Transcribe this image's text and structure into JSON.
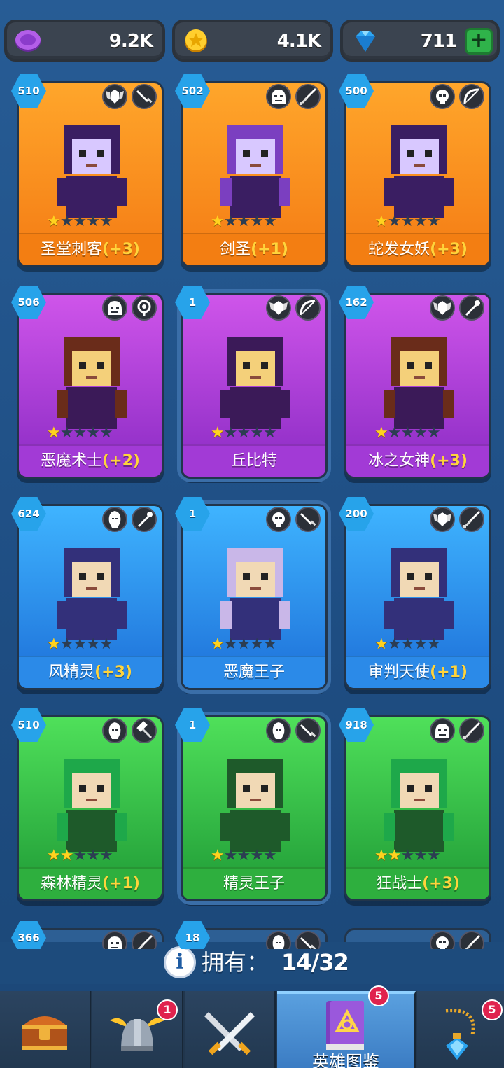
{
  "resources": {
    "purple_currency": "9.2K",
    "gold_coins": "4.1K",
    "gems": "711",
    "gems_add_label": "+"
  },
  "heroes": [
    {
      "name": "圣堂刺客",
      "plus": "(+3)",
      "level": "510",
      "stars": 1,
      "rarity": "orange",
      "faction_icon": "winged-shield-icon",
      "weapon_icon": "dagger-icon",
      "state": "owned"
    },
    {
      "name": "剑圣",
      "plus": "(+1)",
      "level": "502",
      "stars": 1,
      "rarity": "orange",
      "faction_icon": "orc-helm-icon",
      "weapon_icon": "sword-icon",
      "state": "owned"
    },
    {
      "name": "蛇发女妖",
      "plus": "(+3)",
      "level": "500",
      "stars": 1,
      "rarity": "orange",
      "faction_icon": "demon-skull-icon",
      "weapon_icon": "bow-icon",
      "state": "owned"
    },
    {
      "name": "恶魔术士",
      "plus": "(+2)",
      "level": "506",
      "stars": 1,
      "rarity": "purple",
      "faction_icon": "orc-helm-icon",
      "weapon_icon": "orb-icon",
      "state": "owned"
    },
    {
      "name": "丘比特",
      "plus": "",
      "level": "1",
      "stars": 1,
      "rarity": "purple",
      "faction_icon": "winged-shield-icon",
      "weapon_icon": "bow-icon",
      "state": "selected"
    },
    {
      "name": "冰之女神",
      "plus": "(+3)",
      "level": "162",
      "stars": 1,
      "rarity": "purple",
      "faction_icon": "winged-shield-icon",
      "weapon_icon": "staff-icon",
      "state": "owned"
    },
    {
      "name": "风精灵",
      "plus": "(+3)",
      "level": "624",
      "stars": 1,
      "rarity": "blue",
      "faction_icon": "elf-icon",
      "weapon_icon": "staff-icon",
      "state": "owned"
    },
    {
      "name": "恶魔王子",
      "plus": "",
      "level": "1",
      "stars": 1,
      "rarity": "blue",
      "faction_icon": "demon-skull-icon",
      "weapon_icon": "dagger-icon",
      "state": "selected"
    },
    {
      "name": "审判天使",
      "plus": "(+1)",
      "level": "200",
      "stars": 1,
      "rarity": "blue",
      "faction_icon": "winged-shield-icon",
      "weapon_icon": "sword-icon",
      "state": "owned"
    },
    {
      "name": "森林精灵",
      "plus": "(+1)",
      "level": "510",
      "stars": 2,
      "rarity": "green",
      "faction_icon": "elf-icon",
      "weapon_icon": "hammer-icon",
      "state": "owned"
    },
    {
      "name": "精灵王子",
      "plus": "",
      "level": "1",
      "stars": 1,
      "rarity": "green",
      "faction_icon": "elf-icon",
      "weapon_icon": "dagger-icon",
      "state": "selected"
    },
    {
      "name": "狂战士",
      "plus": "(+3)",
      "level": "918",
      "stars": 2,
      "rarity": "green",
      "faction_icon": "orc-helm-icon",
      "weapon_icon": "sword-icon",
      "state": "owned"
    },
    {
      "name": "",
      "plus": "",
      "level": "366",
      "stars": 0,
      "rarity": "green",
      "faction_icon": "orc-helm-icon",
      "weapon_icon": "sword-icon",
      "state": "partial"
    },
    {
      "name": "",
      "plus": "",
      "level": "18",
      "stars": 0,
      "rarity": "blue",
      "faction_icon": "elf-icon",
      "weapon_icon": "dagger-icon",
      "state": "partial"
    },
    {
      "name": "",
      "plus": "",
      "level": "",
      "stars": 0,
      "rarity": "blue",
      "faction_icon": "demon-skull-icon",
      "weapon_icon": "sword-icon",
      "state": "partial"
    }
  ],
  "owned": {
    "label": "拥有：",
    "count": "14/32"
  },
  "nav": {
    "tabs": [
      {
        "id": "chest",
        "icon": "treasure-chest-icon",
        "badge": ""
      },
      {
        "id": "heroes",
        "icon": "winged-helmet-icon",
        "badge": "1"
      },
      {
        "id": "battle",
        "icon": "crossed-swords-icon",
        "badge": ""
      },
      {
        "id": "codex",
        "icon": "spell-book-icon",
        "badge": "5",
        "label": "英雄图鉴",
        "active": true
      },
      {
        "id": "equipment",
        "icon": "amulet-icon",
        "badge": "5"
      }
    ]
  },
  "colors": {
    "background": "#275c95",
    "card_orange": "#f47b14",
    "card_purple": "#a23ad6",
    "card_blue": "#2b8ae8",
    "card_green": "#2eaf3e",
    "level_badge": "#27a3ea",
    "plus_text": "#ffd43b",
    "notif_red": "#e0234e"
  }
}
